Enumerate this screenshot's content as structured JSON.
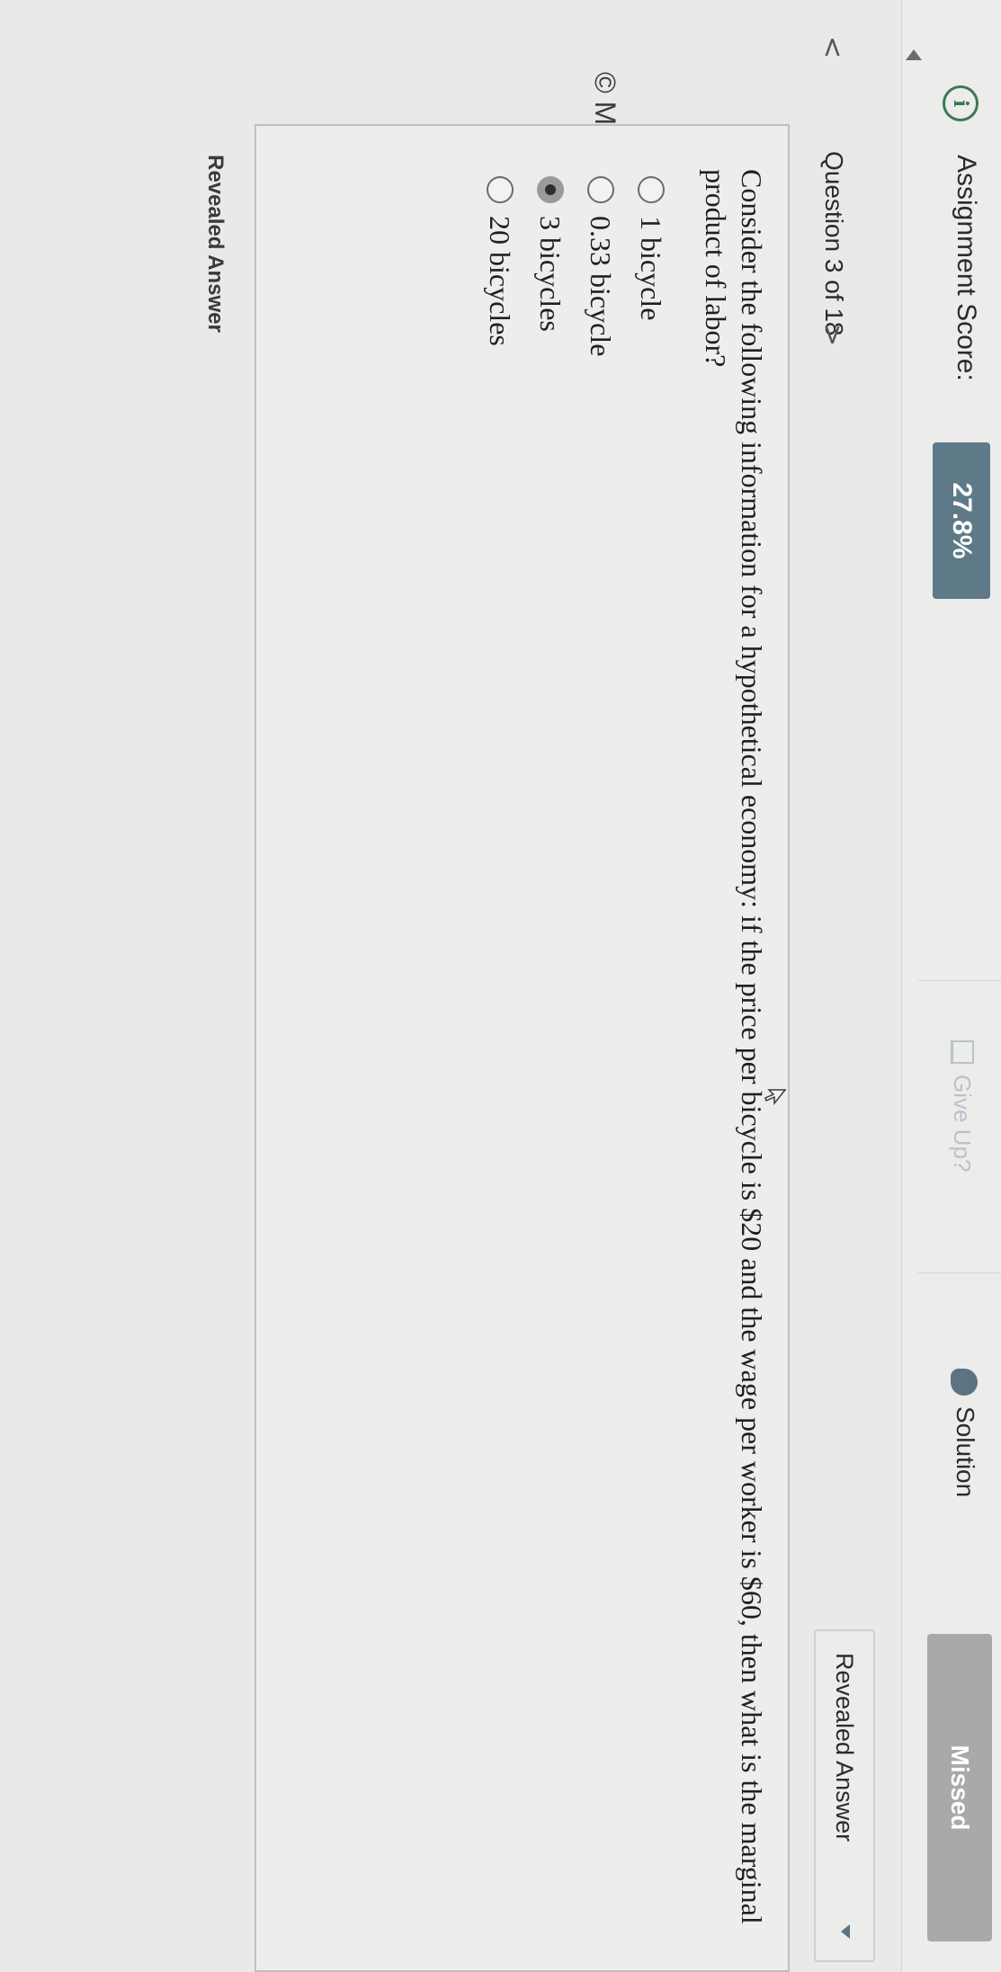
{
  "header": {
    "score_label": "Assignment Score:",
    "score_value": "27.8%",
    "give_up_label": "Give Up?",
    "solution_label": "Solution",
    "status_label": "Missed"
  },
  "navigation": {
    "question_label": "Question 3 of 18",
    "view_dropdown_label": "Revealed Answer"
  },
  "copyright": "© Macmillan Learning",
  "question": {
    "text": "Consider the following information for a hypothetical economy: if the price per bicycle is $20 and the wage per worker is $60, then what is the marginal product of labor?",
    "options": [
      {
        "label": "1 bicycle",
        "selected": false
      },
      {
        "label": "0.33 bicycle",
        "selected": false
      },
      {
        "label": "3 bicycles",
        "selected": true
      },
      {
        "label": "20 bicycles",
        "selected": false
      }
    ]
  },
  "footer": {
    "revealed_answer_label": "Revealed Answer"
  },
  "colors": {
    "score_badge": "#5e7a88",
    "missed_button": "#a9a9a8",
    "info_icon": "#3b7a50",
    "accent_icon": "#5b7382"
  }
}
